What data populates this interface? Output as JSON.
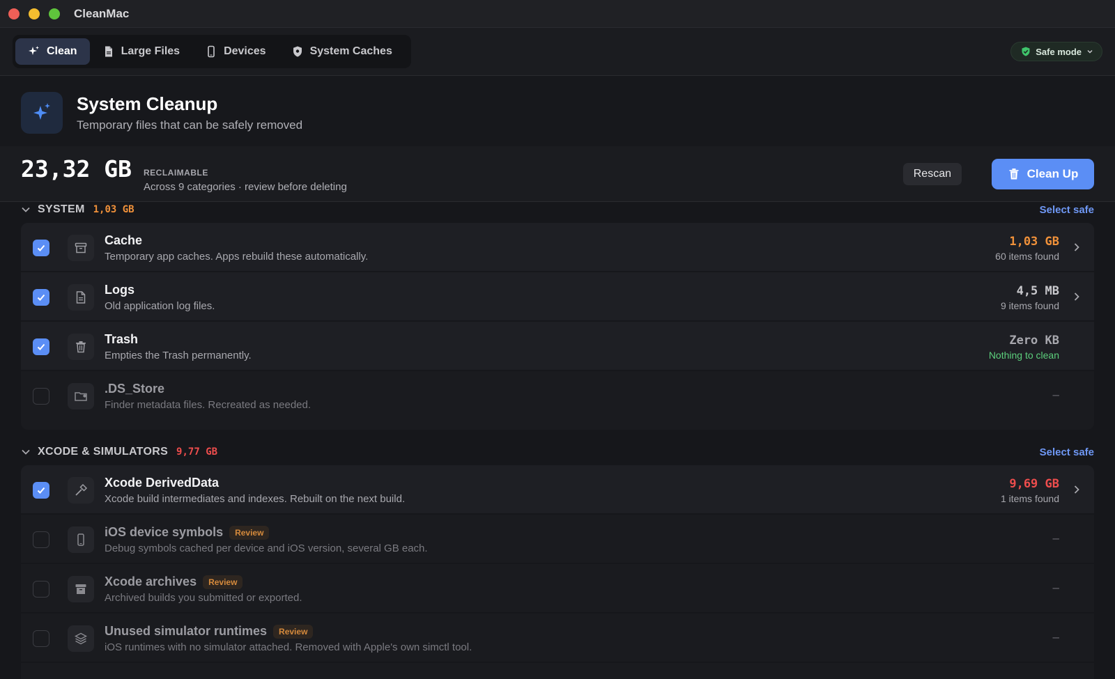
{
  "app": {
    "title": "CleanMac"
  },
  "tabs": [
    {
      "label": "Clean",
      "icon": "sparkle-icon",
      "active": true
    },
    {
      "label": "Large Files",
      "icon": "document-icon",
      "active": false
    },
    {
      "label": "Devices",
      "icon": "phone-icon",
      "active": false
    },
    {
      "label": "System Caches",
      "icon": "shield-icon",
      "active": false
    }
  ],
  "safe_mode": {
    "label": "Safe mode"
  },
  "hero": {
    "title": "System Cleanup",
    "subtitle": "Temporary files that can be safely removed"
  },
  "summary": {
    "size": "23,32 GB",
    "label": "RECLAIMABLE",
    "subtitle": "Across 9 categories · review before deleting",
    "rescan_label": "Rescan",
    "cleanup_label": "Clean Up"
  },
  "sections": [
    {
      "name": "SYSTEM",
      "size": "1,03 GB",
      "size_color": "#f0913a",
      "select_label": "Select safe",
      "items": [
        {
          "name": "Cache",
          "desc": "Temporary app caches. Apps rebuild these automatically.",
          "size": "1,03 GB",
          "size_color": "#f0913a",
          "count": "60 items found",
          "checked": true,
          "icon": "archive-box-icon"
        },
        {
          "name": "Logs",
          "desc": "Old application log files.",
          "size": "4,5 MB",
          "size_color": "#c9c9cd",
          "count": "9 items found",
          "checked": true,
          "icon": "log-file-icon"
        },
        {
          "name": "Trash",
          "desc": "Empties the Trash permanently.",
          "size": "Zero KB",
          "size_color": "#a8a8ae",
          "count": "Nothing to clean",
          "count_color": "#5ccf7c",
          "checked": true,
          "icon": "trash-icon"
        },
        {
          "name": ".DS_Store",
          "desc": "Finder metadata files. Recreated as needed.",
          "dash": "–",
          "checked": false,
          "icon": "folder-icon"
        }
      ]
    },
    {
      "name": "XCODE & SIMULATORS",
      "size": "9,77 GB",
      "size_color": "#ee4d4d",
      "select_label": "Select safe",
      "items": [
        {
          "name": "Xcode DerivedData",
          "desc": "Xcode build intermediates and indexes. Rebuilt on the next build.",
          "size": "9,69 GB",
          "size_color": "#ee4d4d",
          "count": "1 items found",
          "checked": true,
          "icon": "hammer-icon"
        },
        {
          "name": "iOS device symbols",
          "badge": "Review",
          "desc": "Debug symbols cached per device and iOS version, several GB each.",
          "dash": "–",
          "checked": false,
          "icon": "device-icon"
        },
        {
          "name": "Xcode archives",
          "badge": "Review",
          "desc": "Archived builds you submitted or exported.",
          "dash": "–",
          "checked": false,
          "icon": "archive-icon"
        },
        {
          "name": "Unused simulator runtimes",
          "badge": "Review",
          "desc": "iOS runtimes with no simulator attached. Removed with Apple's own simctl tool.",
          "dash": "–",
          "checked": false,
          "icon": "layers-icon"
        }
      ]
    }
  ]
}
